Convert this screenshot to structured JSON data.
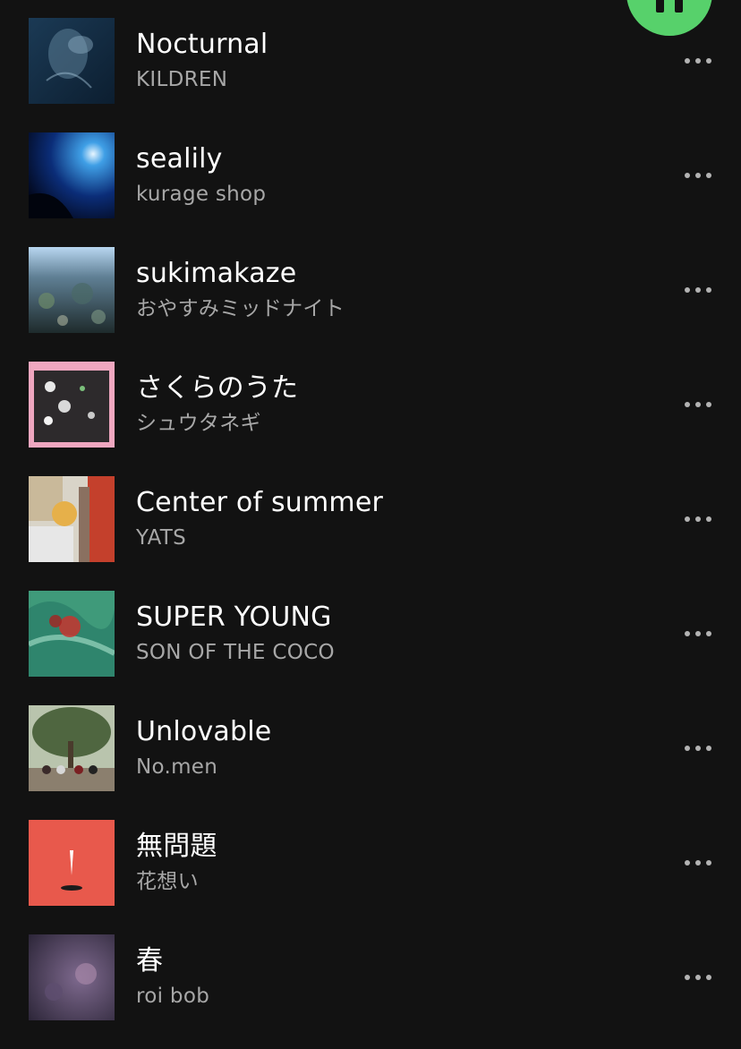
{
  "colors": {
    "background": "#121212",
    "title": "#ffffff",
    "subtitle": "#a7a7a7",
    "accent_green": "#57d16b"
  },
  "player": {
    "play_button_icon": "pause-icon"
  },
  "tracks": [
    {
      "title": "Nocturnal",
      "artist": "KILDREN",
      "cover_icon": "album-cover"
    },
    {
      "title": "sealily",
      "artist": "kurage shop",
      "cover_icon": "album-cover"
    },
    {
      "title": "sukimakaze",
      "artist": "おやすみミッドナイト",
      "cover_icon": "album-cover"
    },
    {
      "title": "さくらのうた",
      "artist": "シュウタネギ",
      "cover_icon": "album-cover"
    },
    {
      "title": "Center of summer",
      "artist": "YATS",
      "cover_icon": "album-cover"
    },
    {
      "title": "SUPER YOUNG",
      "artist": "SON OF THE COCO",
      "cover_icon": "album-cover"
    },
    {
      "title": "Unlovable",
      "artist": "No.men",
      "cover_icon": "album-cover"
    },
    {
      "title": "無問題",
      "artist": "花想い",
      "cover_icon": "album-cover"
    },
    {
      "title": "春",
      "artist": "roi bob",
      "cover_icon": "album-cover"
    }
  ],
  "more_icon": "more-options-icon"
}
